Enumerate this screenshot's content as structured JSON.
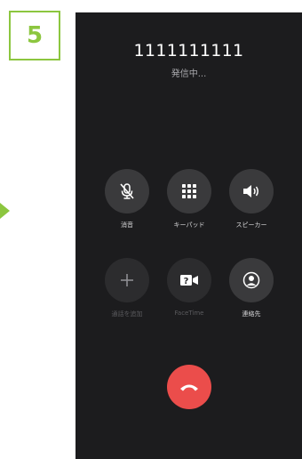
{
  "step": {
    "number": "5",
    "color": "#8cc63f"
  },
  "call": {
    "number": "1111111111",
    "status": "発信中..."
  },
  "keys": [
    {
      "label": "消音",
      "icon": "mute-mic-icon"
    },
    {
      "label": "キーパッド",
      "icon": "keypad-icon"
    },
    {
      "label": "スピーカー",
      "icon": "speaker-icon"
    },
    {
      "label": "通話を追加",
      "icon": "plus-icon",
      "disabled": true
    },
    {
      "label": "FaceTime",
      "icon": "facetime-icon",
      "disabled": true
    },
    {
      "label": "連絡先",
      "icon": "contacts-icon"
    }
  ],
  "end_call": {
    "icon": "end-call-icon",
    "color": "#eb4d4b"
  }
}
